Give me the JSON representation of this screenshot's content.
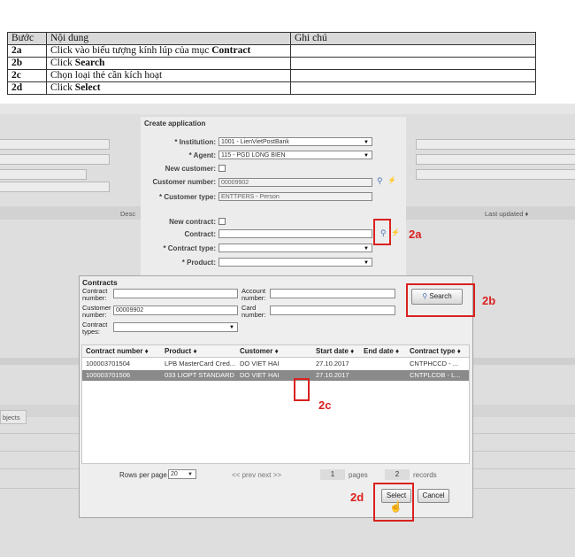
{
  "table": {
    "headers": [
      "Bước",
      "Nội dung",
      "Ghi chú"
    ],
    "rows": [
      {
        "step": "2a",
        "pre": "Click vào biểu tượng kính lúp của mục ",
        "strong": "Contract",
        "note": ""
      },
      {
        "step": "2b",
        "pre": "Click ",
        "strong": "Search",
        "note": ""
      },
      {
        "step": "2c",
        "pre": "Chọn loại thẻ cần kích hoạt",
        "strong": "",
        "note": ""
      },
      {
        "step": "2d",
        "pre": "Click ",
        "strong": "Select",
        "note": ""
      }
    ]
  },
  "background": {
    "column_desc": "Desc",
    "column_last_updated": "Last updated ♦",
    "tab_objects": "bjects"
  },
  "create_app": {
    "title": "Create application",
    "institution_label": "* Institution:",
    "institution_value": "1001 - LienVietPostBank",
    "agent_label": "* Agent:",
    "agent_value": "115 - PGD LONG BIEN",
    "new_customer_label": "New customer:",
    "customer_number_label": "Customer number:",
    "customer_number_value": "00009902",
    "customer_type_label": "* Customer type:",
    "customer_type_value": "ENTTPERS - Person",
    "new_contract_label": "New contract:",
    "contract_label": "Contract:",
    "contract_type_label": "* Contract type:",
    "product_label": "* Product:"
  },
  "contracts": {
    "title": "Contracts",
    "contract_number_label": "Contract number:",
    "account_number_label": "Account number:",
    "customer_number_label": "Customer number:",
    "customer_number_value": "00009902",
    "card_number_label": "Card number:",
    "contract_types_label": "Contract types:",
    "search_label": "Search",
    "columns": [
      "Contract number ♦",
      "Product ♦",
      "Customer ♦",
      "Start date ♦",
      "End date ♦",
      "Contract type ♦"
    ],
    "rows": [
      [
        "100003701504",
        "LPB MasterCard Cred...",
        "DO VIET HAI",
        "27.10.2017",
        "",
        "CNTPHCCD - ..."
      ],
      [
        "100003701506",
        "033 LIOPT STANDARD",
        "DO VIET HAI",
        "27.10.2017",
        "",
        "CNTPLCDB - L..."
      ]
    ],
    "rows_per_page_label": "Rows per page",
    "rows_per_page_value": "20",
    "pager_nav": "<< prev next >>",
    "pages_value": "1",
    "pages_label": "pages",
    "records_value": "2",
    "records_label": "records",
    "select_label": "Select",
    "cancel_label": "Cancel"
  },
  "annotations": {
    "a": "2a",
    "b": "2b",
    "c": "2c",
    "d": "2d"
  },
  "colors": {
    "annotation_red": "#d9211f",
    "selected_row": "#8a8a8a"
  }
}
